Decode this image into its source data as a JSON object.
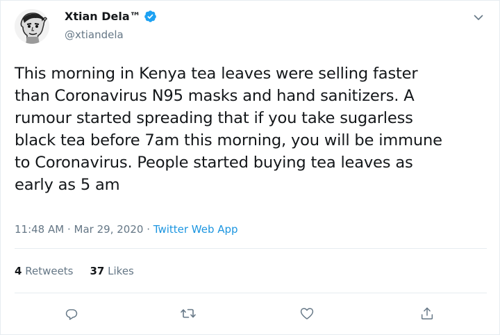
{
  "author": {
    "display_name": "Xtian Dela™",
    "handle": "@xtiandela",
    "verified": true
  },
  "tweet": {
    "lines": [
      "This morning in Kenya tea leaves were selling faster",
      "than Coronavirus N95 masks and hand sanitizers. A",
      "rumour started spreading that if you take sugarless",
      "black tea before 7am this morning, you will be immune",
      "to Coronavirus. People started buying tea leaves as",
      "early as 5 am"
    ],
    "time": "11:48 AM",
    "date": "Mar 29, 2020",
    "separator": "·",
    "source": "Twitter Web App"
  },
  "stats": {
    "retweets_count": "4",
    "retweets_label": "Retweets",
    "likes_count": "37",
    "likes_label": "Likes"
  },
  "icons": {
    "menu": "chevron-down-icon",
    "reply": "reply-icon",
    "retweet": "retweet-icon",
    "like": "heart-icon",
    "share": "share-icon",
    "verified": "verified-badge-icon"
  },
  "colors": {
    "text": "#14171a",
    "secondary": "#657786",
    "link": "#1b95e0",
    "verified": "#1da1f2",
    "border": "#e6ecf0"
  }
}
